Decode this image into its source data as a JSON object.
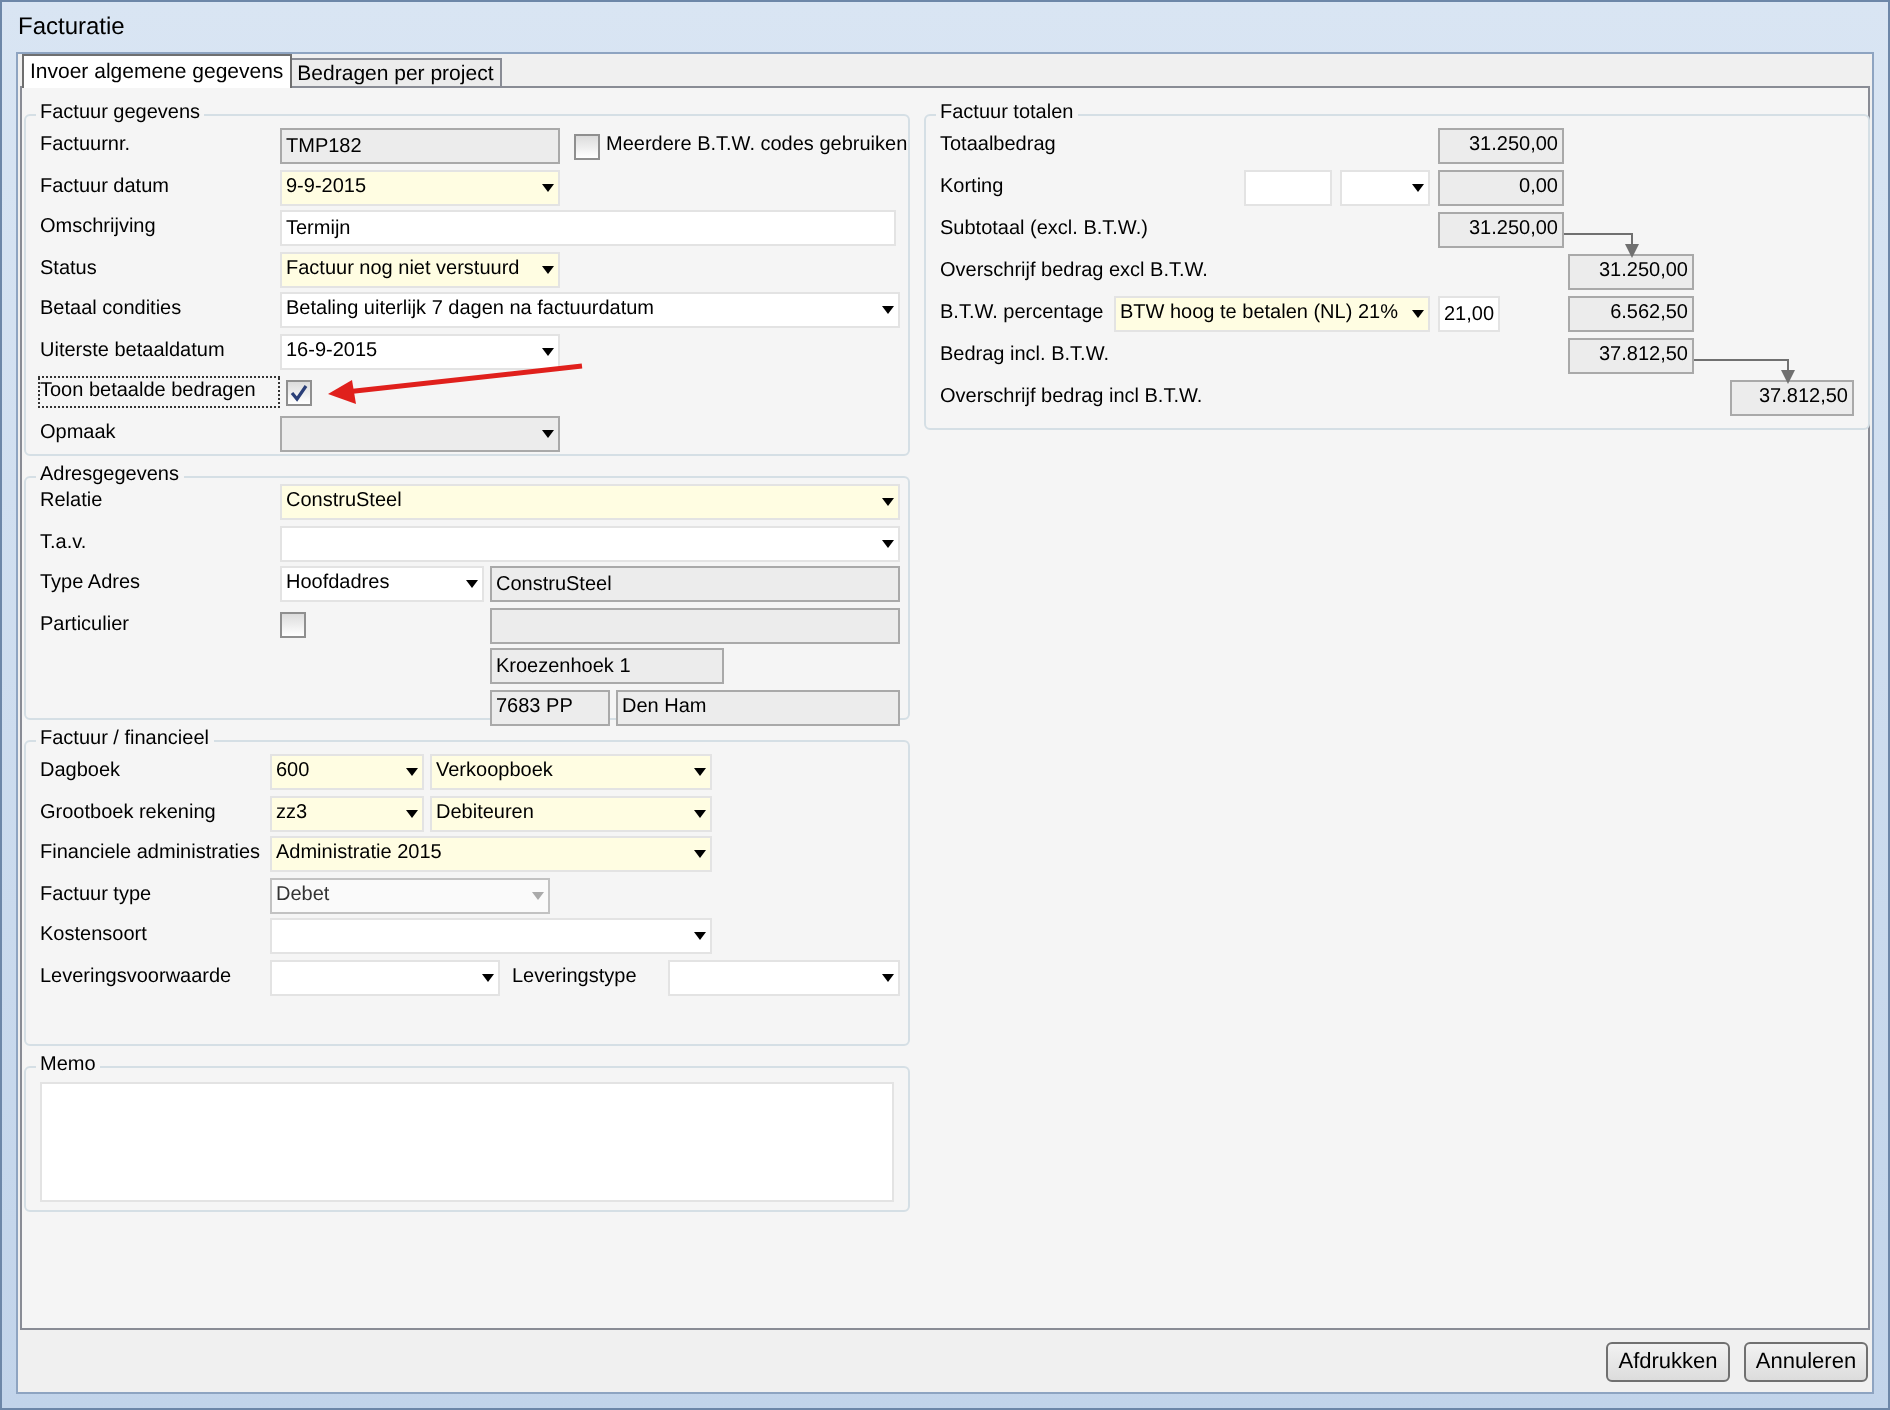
{
  "window": {
    "title": "Facturatie"
  },
  "tabs": [
    {
      "label": "Invoer algemene gegevens",
      "selected": true
    },
    {
      "label": "Bedragen per project",
      "selected": false
    }
  ],
  "sections": [
    {
      "title": "Factuur gegevens",
      "rows": [
        {
          "label": "Factuurnr.",
          "controls": [
            {
              "kind": "text",
              "required": false,
              "readonly": true,
              "disabled": false,
              "value": "TMP182"
            },
            {
              "kind": "check",
              "checked": false,
              "label": "Meerdere B.T.W. codes gebruiken"
            }
          ]
        },
        {
          "label": "Factuur datum",
          "controls": [
            {
              "kind": "select",
              "required": true,
              "readonly": false,
              "disabled": false,
              "value": "9-9-2015"
            }
          ]
        },
        {
          "label": "Omschrijving",
          "controls": [
            {
              "kind": "text",
              "required": false,
              "readonly": false,
              "disabled": false,
              "value": "Termijn"
            }
          ]
        },
        {
          "label": "Status",
          "controls": [
            {
              "kind": "select",
              "required": true,
              "readonly": false,
              "disabled": false,
              "value": "Factuur nog niet verstuurd"
            }
          ]
        },
        {
          "label": "Betaal condities",
          "controls": [
            {
              "kind": "select",
              "required": false,
              "readonly": false,
              "disabled": false,
              "value": "Betaling uiterlijk 7 dagen na factuurdatum"
            }
          ]
        },
        {
          "label": "Uiterste betaaldatum",
          "controls": [
            {
              "kind": "select",
              "required": false,
              "readonly": false,
              "disabled": false,
              "value": "16-9-2015"
            }
          ]
        },
        {
          "label": "Toon betaalde bedragen",
          "focused": true,
          "controls": [
            {
              "kind": "check",
              "checked": true
            }
          ]
        },
        {
          "label": "Opmaak",
          "controls": [
            {
              "kind": "select",
              "required": false,
              "readonly": true,
              "disabled": false
            }
          ]
        }
      ]
    },
    {
      "title": "Adresgegevens",
      "rows": [
        {
          "label": "Relatie",
          "controls": [
            {
              "kind": "select",
              "required": true,
              "readonly": false,
              "disabled": false,
              "value": "ConstruSteel"
            }
          ]
        },
        {
          "label": "T.a.v.",
          "controls": [
            {
              "kind": "select",
              "required": false,
              "readonly": false,
              "disabled": false
            }
          ]
        },
        {
          "label": "Type Adres",
          "controls": [
            {
              "kind": "select",
              "required": false,
              "readonly": false,
              "disabled": false,
              "value": "Hoofdadres"
            },
            {
              "kind": "text",
              "required": false,
              "readonly": true,
              "disabled": false,
              "value": "ConstruSteel"
            }
          ]
        },
        {
          "label": "Particulier",
          "controls": [
            {
              "kind": "check",
              "checked": false
            },
            {
              "kind": "text",
              "required": false,
              "readonly": true,
              "disabled": false
            }
          ]
        },
        {
          "controls": [
            {
              "kind": "text",
              "required": false,
              "readonly": true,
              "disabled": false,
              "value": "Kroezenhoek 1"
            }
          ]
        },
        {
          "controls": [
            {
              "kind": "text",
              "required": false,
              "readonly": true,
              "disabled": false,
              "value": "7683 PP"
            },
            {
              "kind": "text",
              "required": false,
              "readonly": true,
              "disabled": false,
              "value": "Den Ham"
            }
          ]
        }
      ]
    },
    {
      "title": "Factuur / financieel",
      "rows": [
        {
          "label": "Dagboek",
          "controls": [
            {
              "kind": "select",
              "required": true,
              "readonly": false,
              "disabled": false,
              "value": "600"
            },
            {
              "kind": "select",
              "required": true,
              "readonly": false,
              "disabled": false,
              "value": "Verkoopboek"
            }
          ]
        },
        {
          "label": "Grootboek rekening",
          "controls": [
            {
              "kind": "select",
              "required": true,
              "readonly": false,
              "disabled": false,
              "value": "zz3"
            },
            {
              "kind": "select",
              "required": true,
              "readonly": false,
              "disabled": false,
              "value": "Debiteuren"
            }
          ]
        },
        {
          "label": "Financiele administraties",
          "controls": [
            {
              "kind": "select",
              "required": true,
              "readonly": false,
              "disabled": false,
              "value": "Administratie 2015"
            }
          ]
        },
        {
          "label": "Factuur type",
          "controls": [
            {
              "kind": "select",
              "required": false,
              "readonly": false,
              "disabled": true,
              "value": "Debet"
            }
          ]
        },
        {
          "label": "Kostensoort",
          "controls": [
            {
              "kind": "select",
              "required": false,
              "readonly": false,
              "disabled": false
            }
          ]
        },
        {
          "label": "Leveringsvoorwaarde",
          "controls": [
            {
              "kind": "select",
              "required": false,
              "readonly": false,
              "disabled": false
            },
            {
              "kind": "label",
              "text": "Leveringstype"
            },
            {
              "kind": "select",
              "required": false,
              "readonly": false,
              "disabled": false
            }
          ]
        }
      ]
    }
  ],
  "memo": {
    "title": "Memo"
  },
  "totals": {
    "title": "Factuur totalen",
    "rows": [
      {
        "label": "Totaalbedrag",
        "controls": [
          {
            "kind": "amount",
            "required": false,
            "readonly": true,
            "disabled": false,
            "value": "31.250,00"
          }
        ]
      },
      {
        "label": "Korting",
        "controls": [
          {
            "kind": "text",
            "required": false,
            "readonly": false,
            "disabled": false
          },
          {
            "kind": "select",
            "required": false,
            "readonly": false,
            "disabled": false
          },
          {
            "kind": "amount",
            "required": false,
            "readonly": true,
            "disabled": false,
            "value": "0,00"
          }
        ]
      },
      {
        "label": "Subtotaal (excl. B.T.W.)",
        "controls": [
          {
            "kind": "amount",
            "required": false,
            "readonly": true,
            "disabled": false,
            "value": "31.250,00"
          }
        ]
      },
      {
        "label": "Overschrijf bedrag excl B.T.W.",
        "controls": [
          {
            "kind": "amount",
            "required": false,
            "readonly": true,
            "disabled": false,
            "value": "31.250,00"
          }
        ]
      },
      {
        "label": "B.T.W. percentage",
        "controls": [
          {
            "kind": "select",
            "required": true,
            "readonly": false,
            "disabled": false,
            "value": "BTW hoog te betalen (NL) 21%"
          },
          {
            "kind": "text",
            "required": false,
            "readonly": false,
            "disabled": false,
            "value": "21,00"
          },
          {
            "kind": "amount",
            "required": false,
            "readonly": true,
            "disabled": false,
            "value": "6.562,50"
          }
        ]
      },
      {
        "label": "Bedrag incl. B.T.W.",
        "controls": [
          {
            "kind": "amount",
            "required": false,
            "readonly": true,
            "disabled": false,
            "value": "37.812,50"
          }
        ]
      },
      {
        "label": "Overschrijf bedrag incl B.T.W.",
        "controls": [
          {
            "kind": "amount",
            "required": false,
            "readonly": true,
            "disabled": false,
            "value": "37.812,50"
          }
        ]
      }
    ]
  },
  "buttons": [
    "Afdrukken",
    "Annuleren"
  ]
}
